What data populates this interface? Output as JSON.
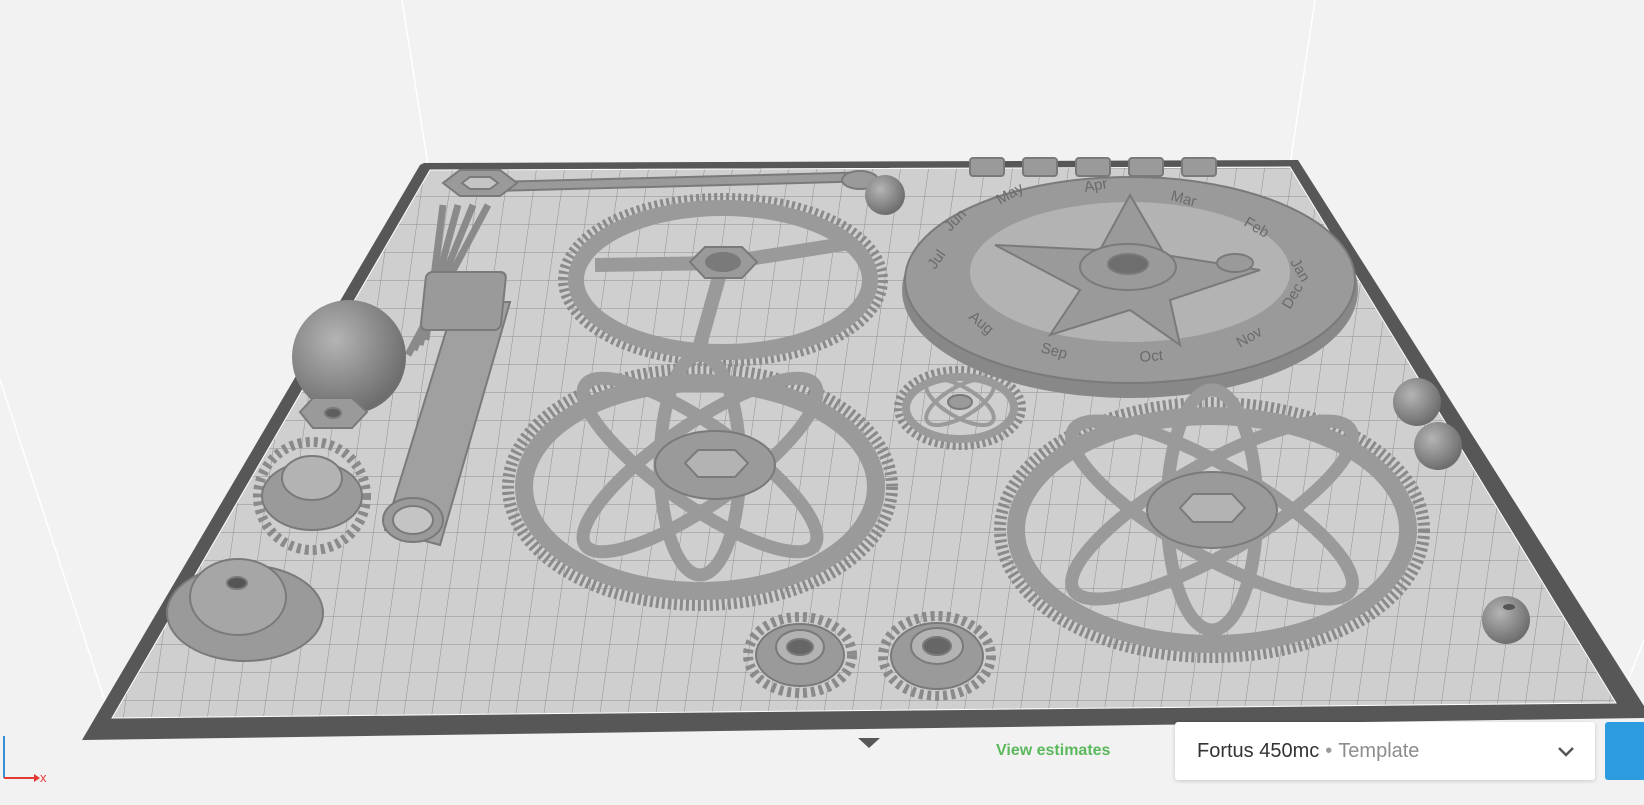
{
  "viewer": {
    "axis_x_label": "x",
    "calendar_months": [
      "Jan",
      "Feb",
      "Mar",
      "Apr",
      "May",
      "Jun",
      "Jul",
      "Aug",
      "Sep",
      "Oct",
      "Nov",
      "Dec"
    ]
  },
  "footer": {
    "view_estimates_label": "View estimates"
  },
  "printer_select": {
    "printer_name": "Fortus 450mc",
    "separator": "•",
    "profile": "Template"
  },
  "colors": {
    "model_gray": "#9a9a9a",
    "plate": "#cfcfcf",
    "plate_border": "#595959",
    "estimates_green": "#5cb85c",
    "action_blue": "#2d9be0"
  },
  "icons": {
    "dropdown": "chevron-down-icon",
    "axis": "axis-gizmo-icon"
  }
}
